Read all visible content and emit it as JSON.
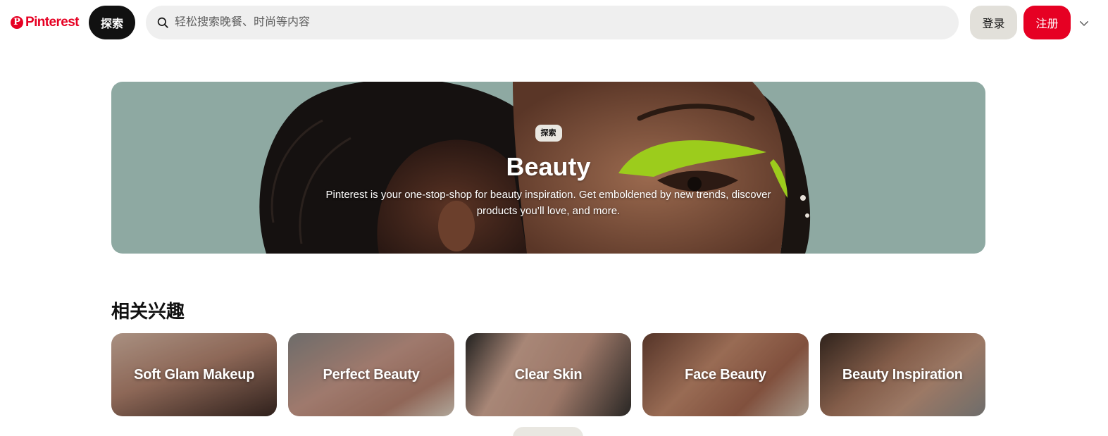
{
  "header": {
    "logo_text": "Pinterest",
    "logo_mark": "P",
    "explore_label": "探索",
    "search_placeholder": "轻松搜索晚餐、时尚等内容",
    "login_label": "登录",
    "signup_label": "注册",
    "icons": {
      "search": "search-icon",
      "more": "chevron-down-icon"
    },
    "colors": {
      "brand": "#e60023",
      "explore_bg": "#111111",
      "search_bg": "#efefef",
      "login_bg": "#e2e0da"
    }
  },
  "hero": {
    "badge": "探索",
    "title": "Beauty",
    "description": "Pinterest is your one-stop-shop for beauty inspiration. Get emboldened by new trends, discover products you’ll love, and more.",
    "colors": {
      "background": "#8ea9a2",
      "eyeshadow": "#9ccc1c"
    }
  },
  "related": {
    "title": "相关兴趣",
    "items": [
      {
        "label": "Soft Glam Makeup"
      },
      {
        "label": "Perfect Beauty"
      },
      {
        "label": "Clear Skin"
      },
      {
        "label": "Face Beauty"
      },
      {
        "label": "Beauty Inspiration"
      }
    ]
  }
}
